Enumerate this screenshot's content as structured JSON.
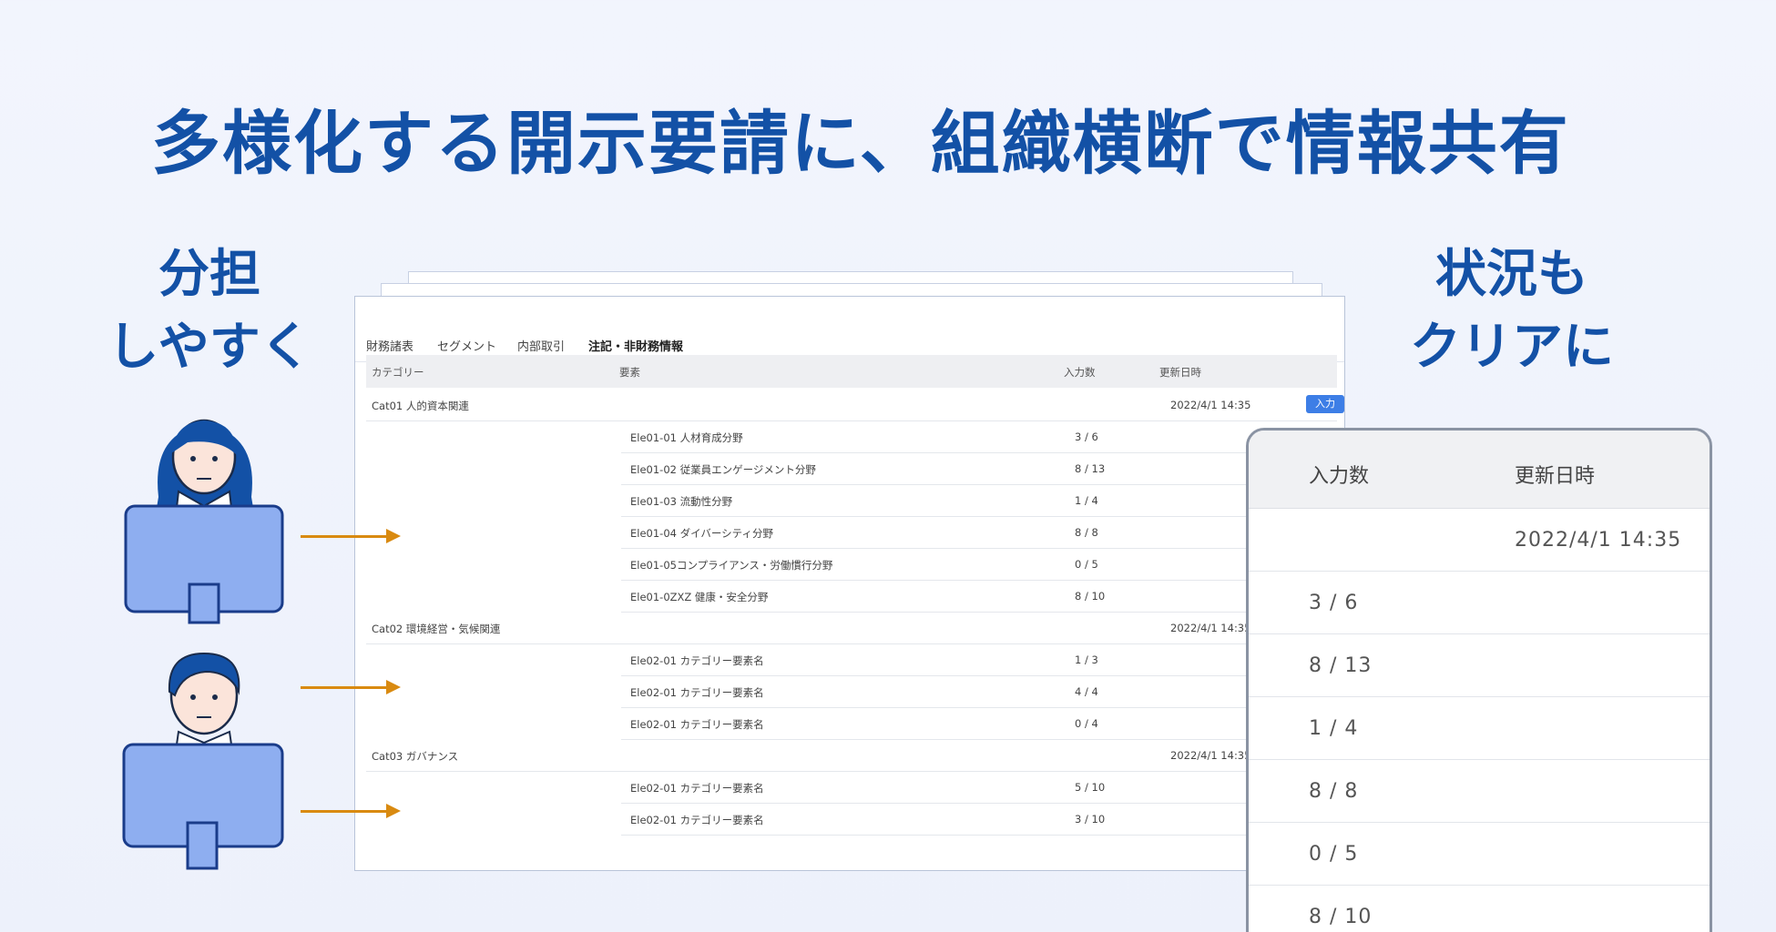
{
  "headline": "多様化する開示要請に、組織横断で情報共有",
  "left_caption": [
    "分担",
    "しやすく"
  ],
  "right_caption": [
    "状況も",
    "クリアに"
  ],
  "colors": {
    "brand": "#1351a6",
    "accent": "#3d7ee6",
    "arrow": "#d98a10",
    "screen": "#8eaef0"
  },
  "tabs": [
    {
      "label": "財務諸表",
      "active": false
    },
    {
      "label": "セグメント",
      "active": false
    },
    {
      "label": "内部取引",
      "active": false
    },
    {
      "label": "注記・非財務情報",
      "active": true
    }
  ],
  "table": {
    "headers": {
      "category": "カテゴリー",
      "element": "要素",
      "count": "入力数",
      "updated": "更新日時"
    },
    "input_button": "入力",
    "rows": [
      {
        "category": "Cat01 人的資本関連",
        "element": "",
        "count": "",
        "updated": "2022/4/1 14:35"
      },
      {
        "category": "",
        "element": "Ele01-01 人材育成分野",
        "count": "3 / 6",
        "updated": ""
      },
      {
        "category": "",
        "element": "Ele01-02 従業員エンゲージメント分野",
        "count": "8 / 13",
        "updated": ""
      },
      {
        "category": "",
        "element": "Ele01-03 流動性分野",
        "count": "1 / 4",
        "updated": ""
      },
      {
        "category": "",
        "element": "Ele01-04 ダイバーシティ分野",
        "count": "8 / 8",
        "updated": ""
      },
      {
        "category": "",
        "element": "Ele01-05コンプライアンス・労働慣行分野",
        "count": "0 / 5",
        "updated": ""
      },
      {
        "category": "",
        "element": "Ele01-0ZXZ 健康・安全分野",
        "count": "8 / 10",
        "updated": ""
      },
      {
        "category": "Cat02 環境経営・気候関連",
        "element": "",
        "count": "",
        "updated": "2022/4/1 14:35"
      },
      {
        "category": "",
        "element": "Ele02-01 カテゴリー要素名",
        "count": "1 / 3",
        "updated": ""
      },
      {
        "category": "",
        "element": "Ele02-01 カテゴリー要素名",
        "count": "4 / 4",
        "updated": ""
      },
      {
        "category": "",
        "element": "Ele02-01 カテゴリー要素名",
        "count": "0 / 4",
        "updated": ""
      },
      {
        "category": "Cat03 ガバナンス",
        "element": "",
        "count": "",
        "updated": "2022/4/1 14:35"
      },
      {
        "category": "",
        "element": "Ele02-01 カテゴリー要素名",
        "count": "5 / 10",
        "updated": ""
      },
      {
        "category": "",
        "element": "Ele02-01 カテゴリー要素名",
        "count": "3 / 10",
        "updated": ""
      }
    ]
  },
  "zoom": {
    "headers": {
      "count": "入力数",
      "updated": "更新日時"
    },
    "rows": [
      {
        "count": "",
        "updated": "2022/4/1 14:35"
      },
      {
        "count": "3 / 6",
        "updated": ""
      },
      {
        "count": "8 / 13",
        "updated": ""
      },
      {
        "count": "1 / 4",
        "updated": ""
      },
      {
        "count": "8 / 8",
        "updated": ""
      },
      {
        "count": "0 / 5",
        "updated": ""
      },
      {
        "count": "8 / 10",
        "updated": ""
      }
    ]
  }
}
